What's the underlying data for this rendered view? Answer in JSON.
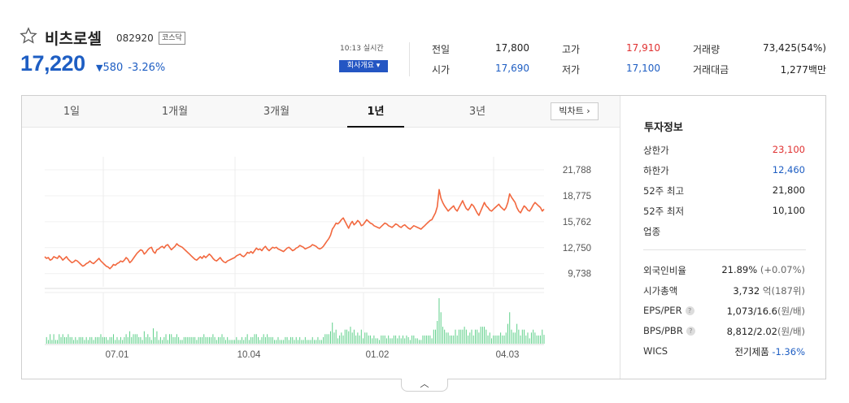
{
  "stock": {
    "name": "비츠로셀",
    "code": "082920",
    "market": "코스닥",
    "price": "17,220",
    "change_symbol": "▼",
    "change": "580",
    "change_pct": "-3.26%",
    "time": "10:13 실시간",
    "company_button": "회사개요 ▾"
  },
  "stats": {
    "prev_close_label": "전일",
    "prev_close": "17,800",
    "high_label": "고가",
    "high": "17,910",
    "volume_label": "거래량",
    "volume": "73,425(54%)",
    "open_label": "시가",
    "open": "17,690",
    "low_label": "저가",
    "low": "17,100",
    "amount_label": "거래대금",
    "amount": "1,277백만"
  },
  "tabs": [
    "1일",
    "1개월",
    "3개월",
    "1년",
    "3년"
  ],
  "active_tab": "1년",
  "big_chart_label": "빅차트 ›",
  "invest": {
    "title": "투자정보",
    "upper_limit_label": "상한가",
    "upper_limit": "23,100",
    "lower_limit_label": "하한가",
    "lower_limit": "12,460",
    "w52_high_label": "52주 최고",
    "w52_high": "21,800",
    "w52_low_label": "52주 최저",
    "w52_low": "10,100",
    "industry_label": "업종",
    "foreign_label": "외국인비율",
    "foreign_val": "21.89%",
    "foreign_chg": "(+0.07%)",
    "mktcap_label": "시가총액",
    "mktcap_val": "3,732",
    "mktcap_unit": "억(187위)",
    "eps_label": "EPS/PER",
    "eps_val": "1,073/16.6",
    "eps_unit": "(원/배)",
    "bps_label": "BPS/PBR",
    "bps_val": "8,812/2.02",
    "bps_unit": "(원/배)",
    "wics_label": "WICS",
    "wics_val": "전기제품",
    "wics_chg": "-1.36%"
  },
  "colors": {
    "up": "#e03131",
    "down": "#1e5ec3",
    "line": "#f2683f",
    "volume": "#5fd08a"
  },
  "chart_data": {
    "type": "line",
    "y_ticks": [
      "21,788",
      "18,775",
      "15,762",
      "12,750",
      "9,738"
    ],
    "x_ticks": [
      "07.01",
      "10.04",
      "01.02",
      "04.03"
    ],
    "ylim": [
      8200,
      23300
    ],
    "price_series": [
      11700,
      11500,
      11600,
      11300,
      11400,
      11700,
      11600,
      11500,
      11800,
      11600,
      11300,
      11500,
      11700,
      11400,
      11200,
      11000,
      11100,
      11300,
      11200,
      11000,
      10800,
      10600,
      10700,
      10900,
      11000,
      11200,
      11000,
      10900,
      11100,
      11300,
      11500,
      11200,
      11000,
      10800,
      10600,
      10500,
      10300,
      10500,
      10800,
      10700,
      10900,
      11000,
      11200,
      11100,
      11300,
      11600,
      11400,
      11000,
      11200,
      11500,
      11800,
      12100,
      12300,
      12500,
      12400,
      12000,
      12200,
      12500,
      12700,
      12800,
      12300,
      12100,
      12500,
      12600,
      12800,
      12900,
      12700,
      13000,
      13100,
      12800,
      12500,
      12700,
      12900,
      13200,
      13000,
      12900,
      12800,
      12600,
      12400,
      12200,
      12000,
      11800,
      11600,
      11400,
      11300,
      11500,
      11700,
      11500,
      11800,
      11600,
      11800,
      12000,
      11800,
      11500,
      11300,
      11200,
      11400,
      11600,
      11300,
      11100,
      11000,
      11200,
      11300,
      11400,
      11500,
      11600,
      11800,
      11900,
      12000,
      11800,
      11700,
      11900,
      12200,
      12100,
      12300,
      12100,
      12400,
      12700,
      12500,
      12600,
      12400,
      12700,
      12900,
      12600,
      12400,
      12600,
      12800,
      12700,
      12800,
      12600,
      12500,
      12400,
      12300,
      12500,
      12700,
      12800,
      12600,
      12400,
      12500,
      12700,
      12800,
      13000,
      12900,
      12800,
      12600,
      12700,
      12800,
      12900,
      13100,
      13000,
      12900,
      12700,
      12600,
      12700,
      12900,
      13200,
      13500,
      13800,
      14200,
      14900,
      15200,
      15600,
      15500,
      15700,
      16000,
      16200,
      15800,
      15400,
      15000,
      15500,
      15800,
      15400,
      15600,
      15900,
      15700,
      15300,
      15400,
      15700,
      16000,
      15800,
      15600,
      15500,
      15300,
      15200,
      15100,
      15000,
      15200,
      15400,
      15600,
      15500,
      15300,
      15200,
      15100,
      15300,
      15500,
      15400,
      15200,
      15100,
      15300,
      15400,
      15200,
      15000,
      14900,
      15100,
      15300,
      15200,
      15100,
      15000,
      14900,
      15100,
      15300,
      15500,
      15700,
      15900,
      16000,
      16400,
      16800,
      17500,
      19500,
      18500,
      18000,
      17600,
      17300,
      17000,
      17200,
      17400,
      17600,
      17200,
      17000,
      17400,
      17800,
      18200,
      17700,
      17300,
      17100,
      17400,
      17800,
      17600,
      17200,
      16800,
      16500,
      17000,
      17500,
      18000,
      17600,
      17400,
      17100,
      17000,
      17200,
      17400,
      17600,
      17800,
      17500,
      17300,
      17100,
      17400,
      18000,
      19000,
      18600,
      18300,
      18000,
      17400,
      17000,
      16800,
      17200,
      17600,
      17400,
      17100,
      17000,
      17300,
      17700,
      18000,
      17800,
      17600,
      17400,
      17000,
      17220
    ]
  }
}
